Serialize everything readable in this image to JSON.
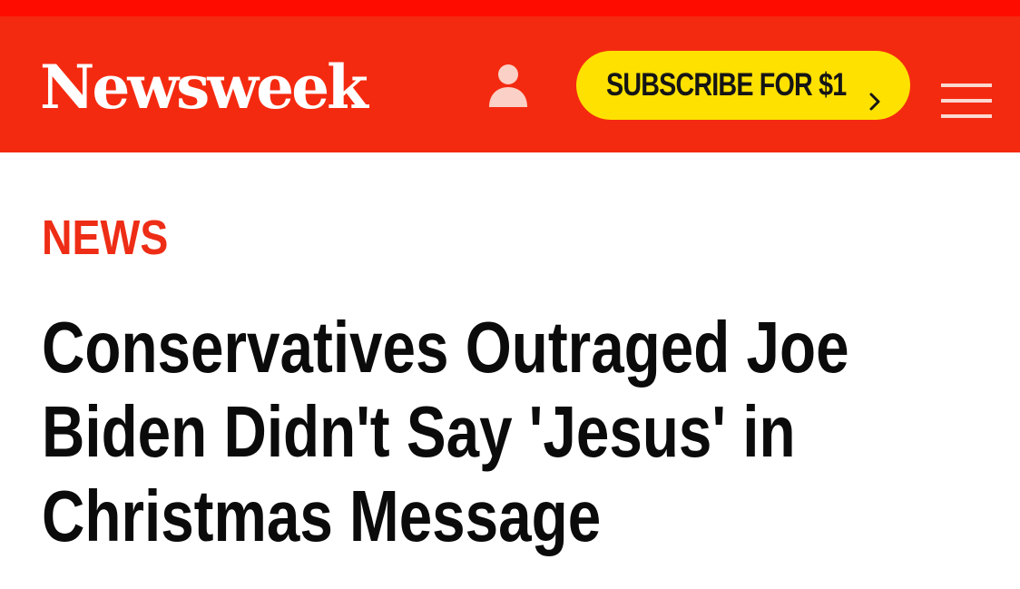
{
  "header": {
    "logo_text": "Newsweek",
    "subscribe_label": "SUBSCRIBE FOR $1",
    "accent_color": "#f42a10",
    "subscribe_color": "#ffe100"
  },
  "icons": {
    "account": "user-icon",
    "subscribe_arrow": "chevron-right-icon",
    "menu": "hamburger-menu-icon"
  },
  "article": {
    "category": "NEWS",
    "headline_lines": [
      "Conservatives Outraged Joe",
      "Biden Didn't Say 'Jesus' in",
      "Christmas Message"
    ]
  }
}
